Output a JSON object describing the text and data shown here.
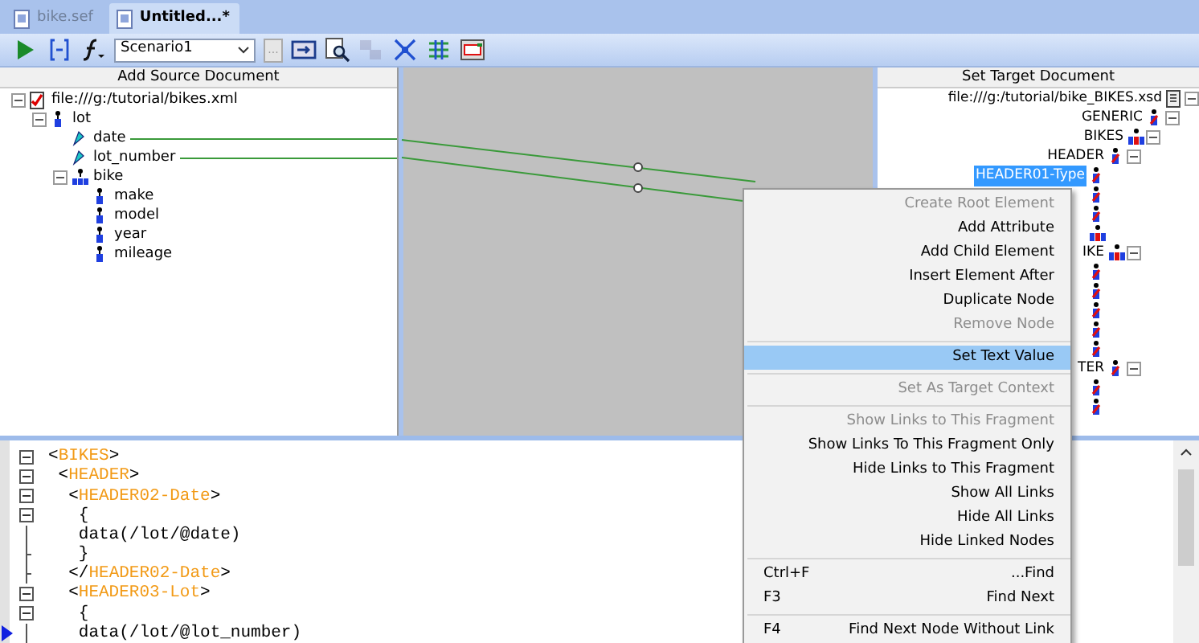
{
  "tabs": [
    {
      "label": "bike.sef",
      "selected": false
    },
    {
      "label": "Untitled...*",
      "selected": true
    }
  ],
  "toolbar": {
    "buttons_left": [
      {
        "kind": "run",
        "disabled": false
      },
      {
        "kind": "link",
        "disabled": false
      },
      {
        "kind": "function",
        "disabled": false
      }
    ],
    "scenario": {
      "value": "Scenario1"
    },
    "browse_button": {
      "label": "...",
      "disabled": true
    },
    "buttons_right": [
      {
        "kind": "export",
        "disabled": false
      },
      {
        "kind": "preview",
        "disabled": false
      },
      {
        "kind": "layout",
        "disabled": true
      },
      {
        "kind": "collapse",
        "disabled": false
      },
      {
        "kind": "split",
        "disabled": false
      },
      {
        "kind": "window",
        "disabled": false
      }
    ]
  },
  "source": {
    "header": "Add Source Document",
    "tree": [
      {
        "label": "file:///g:/tutorial/bikes.xml",
        "kind": "file",
        "expanded": true,
        "children": [
          {
            "label": "lot",
            "kind": "element",
            "expanded": true,
            "children": [
              {
                "label": "date",
                "kind": "attribute",
                "linked": true
              },
              {
                "label": "lot_number",
                "kind": "attribute",
                "linked": true
              },
              {
                "label": "bike",
                "kind": "group",
                "expanded": true,
                "children": [
                  {
                    "label": "make",
                    "kind": "element"
                  },
                  {
                    "label": "model",
                    "kind": "element"
                  },
                  {
                    "label": "year",
                    "kind": "element"
                  },
                  {
                    "label": "mileage",
                    "kind": "element"
                  }
                ]
              }
            ]
          }
        ]
      }
    ]
  },
  "target": {
    "header": "Set Target Document",
    "tree": [
      {
        "label": "file:///g:/tutorial/bike_BIKES.xsd",
        "kind": "file",
        "expanded": true,
        "children": [
          {
            "label": "GENERIC",
            "kind": "element",
            "expanded": true,
            "children": [
              {
                "label": "BIKES",
                "kind": "group",
                "expanded": true,
                "children": [
                  {
                    "label": "HEADER",
                    "kind": "element",
                    "expanded": true,
                    "children": [
                      {
                        "label": "HEADER01-Type",
                        "kind": "element",
                        "selected": true
                      },
                      {
                        "kind": "element"
                      },
                      {
                        "kind": "element"
                      },
                      {
                        "kind": "group"
                      }
                    ]
                  },
                  {
                    "label": "IKE",
                    "kind": "group",
                    "expanded": true,
                    "children": [
                      {
                        "kind": "element"
                      },
                      {
                        "kind": "element"
                      },
                      {
                        "kind": "element"
                      },
                      {
                        "kind": "element"
                      },
                      {
                        "kind": "element"
                      }
                    ]
                  },
                  {
                    "label": "TER",
                    "kind": "element",
                    "expanded": true,
                    "children": [
                      {
                        "kind": "element"
                      },
                      {
                        "kind": "element"
                      }
                    ]
                  }
                ]
              }
            ]
          }
        ]
      }
    ]
  },
  "code": {
    "lines": [
      {
        "text": "<BIKES>",
        "kind": "box",
        "current": false
      },
      {
        "text": " <HEADER>",
        "kind": "box",
        "current": false
      },
      {
        "text": "  <HEADER02-Date>",
        "kind": "box",
        "current": false
      },
      {
        "text": "   {",
        "kind": "box",
        "current": false
      },
      {
        "text": "   data(/lot/@date)",
        "kind": "line",
        "current": false
      },
      {
        "text": "   }",
        "kind": "end",
        "current": false
      },
      {
        "text": "  </HEADER02-Date>",
        "kind": "end",
        "current": false
      },
      {
        "text": "  <HEADER03-Lot>",
        "kind": "box",
        "current": false
      },
      {
        "text": "   {",
        "kind": "box",
        "current": false
      },
      {
        "text": "   data(/lot/@lot_number)",
        "kind": "line",
        "current": true
      }
    ]
  },
  "context_menu": {
    "items": [
      {
        "kind": "item",
        "label": "Create Root Element",
        "disabled": true,
        "selected": false
      },
      {
        "kind": "item",
        "label": "Add Attribute",
        "disabled": false,
        "selected": false
      },
      {
        "kind": "item",
        "label": "Add Child Element",
        "disabled": false,
        "selected": false
      },
      {
        "kind": "item",
        "label": "Insert Element After",
        "disabled": false,
        "selected": false
      },
      {
        "kind": "item",
        "label": "Duplicate Node",
        "disabled": false,
        "selected": false
      },
      {
        "kind": "item",
        "label": "Remove Node",
        "disabled": true,
        "selected": false
      },
      {
        "kind": "separator"
      },
      {
        "kind": "item",
        "label": "Set Text Value",
        "disabled": false,
        "selected": true
      },
      {
        "kind": "separator"
      },
      {
        "kind": "item",
        "label": "Set As Target Context",
        "disabled": true,
        "selected": false
      },
      {
        "kind": "separator"
      },
      {
        "kind": "item",
        "label": "Show Links to This Fragment",
        "disabled": true,
        "selected": false
      },
      {
        "kind": "item",
        "label": "Show Links To This Fragment Only",
        "disabled": false,
        "selected": false
      },
      {
        "kind": "item",
        "label": "Hide Links to This Fragment",
        "disabled": false,
        "selected": false
      },
      {
        "kind": "item",
        "label": "Show All Links",
        "disabled": false,
        "selected": false
      },
      {
        "kind": "item",
        "label": "Hide All Links",
        "disabled": false,
        "selected": false
      },
      {
        "kind": "item",
        "label": "Hide Linked Nodes",
        "disabled": false,
        "selected": false
      },
      {
        "kind": "separator"
      },
      {
        "kind": "item",
        "label": "...Find",
        "shortcut": "Ctrl+F",
        "disabled": false,
        "selected": false
      },
      {
        "kind": "item",
        "label": "Find Next",
        "shortcut": "F3",
        "disabled": false,
        "selected": false
      },
      {
        "kind": "separator"
      },
      {
        "kind": "item",
        "label": "Find Next Node Without Link",
        "shortcut": "F4",
        "disabled": false,
        "selected": false
      }
    ]
  }
}
